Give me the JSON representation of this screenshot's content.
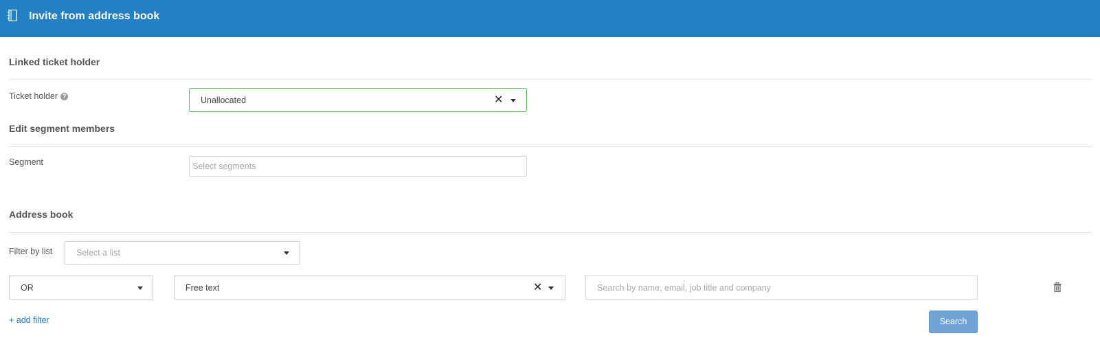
{
  "header": {
    "title": "Invite from address book",
    "icon": "address-book-icon"
  },
  "linked": {
    "section_title": "Linked ticket holder",
    "ticket_holder_label": "Ticket holder",
    "ticket_holder_value": "Unallocated"
  },
  "segment": {
    "section_title": "Edit segment members",
    "segment_label": "Segment",
    "segment_placeholder": "Select segments"
  },
  "address_book": {
    "section_title": "Address book",
    "filter_label": "Filter by list",
    "filter_placeholder": "Select a list",
    "operator_value": "OR",
    "field_value": "Free text",
    "search_placeholder": "Search by name, email, job title and company",
    "add_filter_label": "+ add filter",
    "search_button_label": "Search"
  },
  "colors": {
    "header": "#2380c4",
    "accent_green": "#5cb85c",
    "button": "#6fa3d6"
  }
}
